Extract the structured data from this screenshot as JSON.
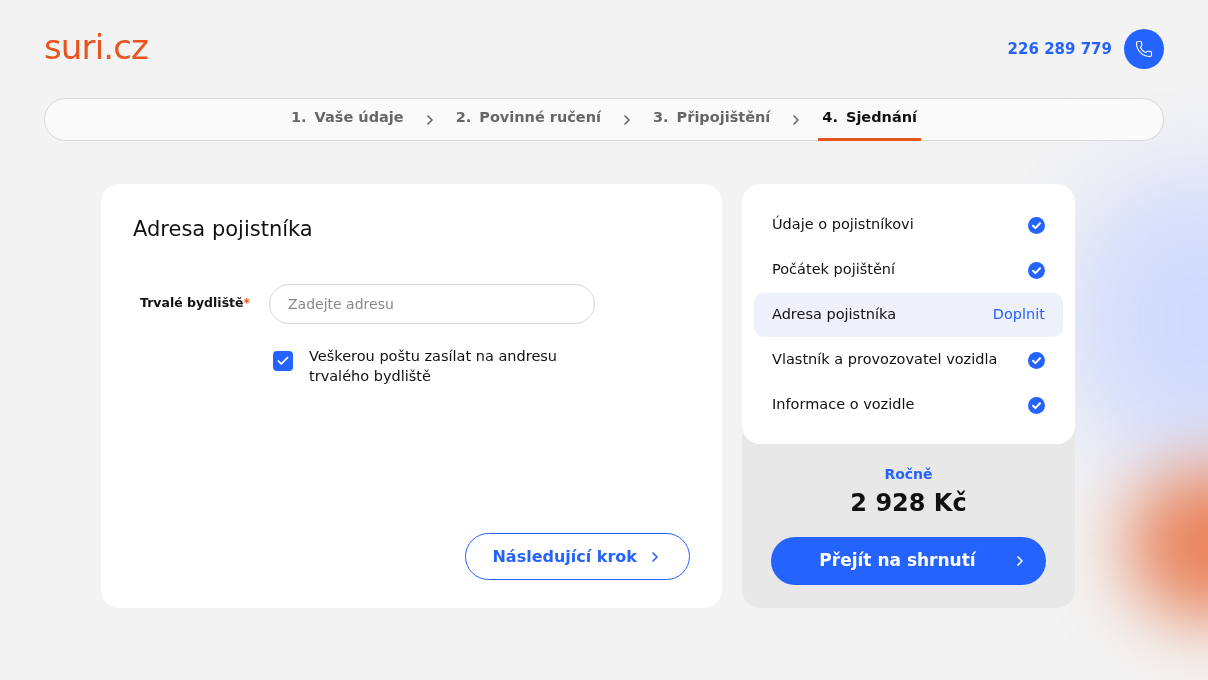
{
  "header": {
    "logo": "suri.cz",
    "phone": "226 289 779"
  },
  "steps": [
    {
      "number": "1.",
      "label": "Vaše údaje",
      "selected": false
    },
    {
      "number": "2.",
      "label": "Povinné ručení",
      "selected": false
    },
    {
      "number": "3.",
      "label": "Připojištění",
      "selected": false
    },
    {
      "number": "4.",
      "label": "Sjednání",
      "selected": true
    }
  ],
  "form": {
    "title": "Adresa pojistníka",
    "field": {
      "label": "Trvalé bydliště",
      "required_mark": "*",
      "placeholder": "Zadejte adresu"
    },
    "checkbox": {
      "label": "Veškerou poštu zasílat na andresu trvalého bydliště",
      "checked": true
    },
    "next_button": "Následující krok"
  },
  "summary": {
    "items": [
      {
        "label": "Údaje o pojistníkovi",
        "kind": "done",
        "selected": false
      },
      {
        "label": "Počátek pojištění",
        "kind": "done",
        "selected": false
      },
      {
        "label": "Adresa pojistníka",
        "kind": "action",
        "action": "Doplnit",
        "selected": true
      },
      {
        "label": "Vlastník a provozovatel vozidla",
        "kind": "done",
        "selected": false
      },
      {
        "label": "Informace o vozidle",
        "kind": "done",
        "selected": false
      }
    ],
    "period": "Ročně",
    "price": "2 928 Kč",
    "button": "Přejít na shrnutí"
  }
}
